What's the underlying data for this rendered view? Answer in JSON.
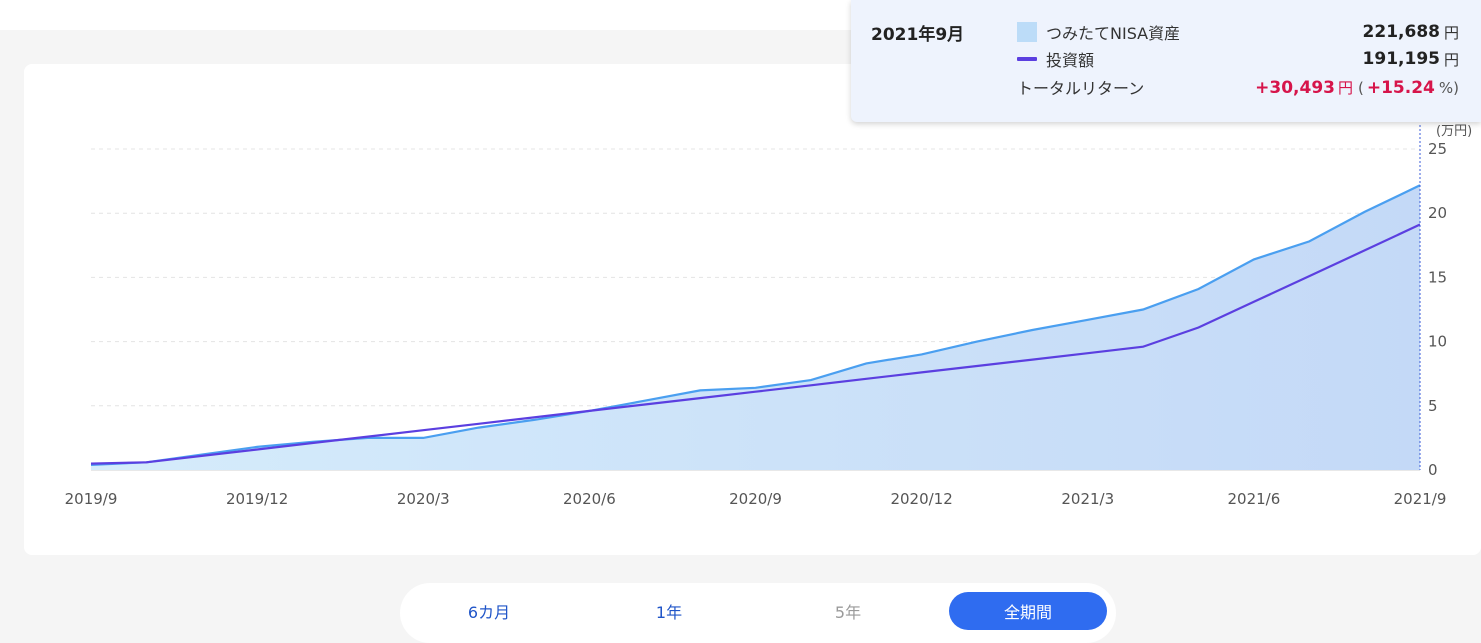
{
  "tooltip": {
    "date": "2021年9月",
    "asset_label": "つみたてNISA資産",
    "asset_value": "221,688",
    "invest_label": "投資額",
    "invest_value": "191,195",
    "unit": "円",
    "return_label": "トータルリターン",
    "return_value": "+30,493",
    "return_percent": "+15.24",
    "paren_open": "(",
    "percent_close": "%)"
  },
  "range_buttons": [
    {
      "label": "6カ月",
      "state": "normal"
    },
    {
      "label": "1年",
      "state": "normal"
    },
    {
      "label": "5年",
      "state": "disabled"
    },
    {
      "label": "全期間",
      "state": "active"
    }
  ],
  "colors": {
    "asset_line": "#4a9ff0",
    "asset_fill_left": "#d5ecfb",
    "asset_fill_right": "#c4d9f7",
    "invest_line": "#5b3fe0",
    "return_positive": "#d6144a",
    "active_button": "#2f6cf0"
  },
  "chart_data": {
    "type": "area",
    "unit_label": "万円",
    "ylim": [
      0,
      25
    ],
    "yticks": [
      "0",
      "5",
      "10",
      "15",
      "20",
      "25"
    ],
    "xtick_labels": [
      "2019/9",
      "2019/12",
      "2020/3",
      "2020/6",
      "2020/9",
      "2020/12",
      "2021/3",
      "2021/6",
      "2021/9"
    ],
    "x": [
      "2019/9",
      "2019/10",
      "2019/11",
      "2019/12",
      "2020/1",
      "2020/2",
      "2020/3",
      "2020/4",
      "2020/5",
      "2020/6",
      "2020/7",
      "2020/8",
      "2020/9",
      "2020/10",
      "2020/11",
      "2020/12",
      "2021/1",
      "2021/2",
      "2021/3",
      "2021/4",
      "2021/5",
      "2021/6",
      "2021/7",
      "2021/8",
      "2021/9"
    ],
    "grid": true,
    "series": [
      {
        "name": "つみたてNISA資産",
        "style": "area",
        "values": [
          0.4,
          0.6,
          1.2,
          1.8,
          2.2,
          2.5,
          2.5,
          3.3,
          3.9,
          4.6,
          5.4,
          6.2,
          6.4,
          7.0,
          8.3,
          9.0,
          10.0,
          10.9,
          11.7,
          12.5,
          14.1,
          16.4,
          17.8,
          20.1,
          22.17
        ]
      },
      {
        "name": "投資額",
        "style": "line",
        "values": [
          0.5,
          0.6,
          1.1,
          1.6,
          2.1,
          2.6,
          3.1,
          3.6,
          4.1,
          4.6,
          5.1,
          5.6,
          6.1,
          6.6,
          7.1,
          7.6,
          8.1,
          8.6,
          9.1,
          9.6,
          11.1,
          13.1,
          15.1,
          17.1,
          19.12
        ]
      }
    ],
    "highlight_x": "2021/9"
  }
}
